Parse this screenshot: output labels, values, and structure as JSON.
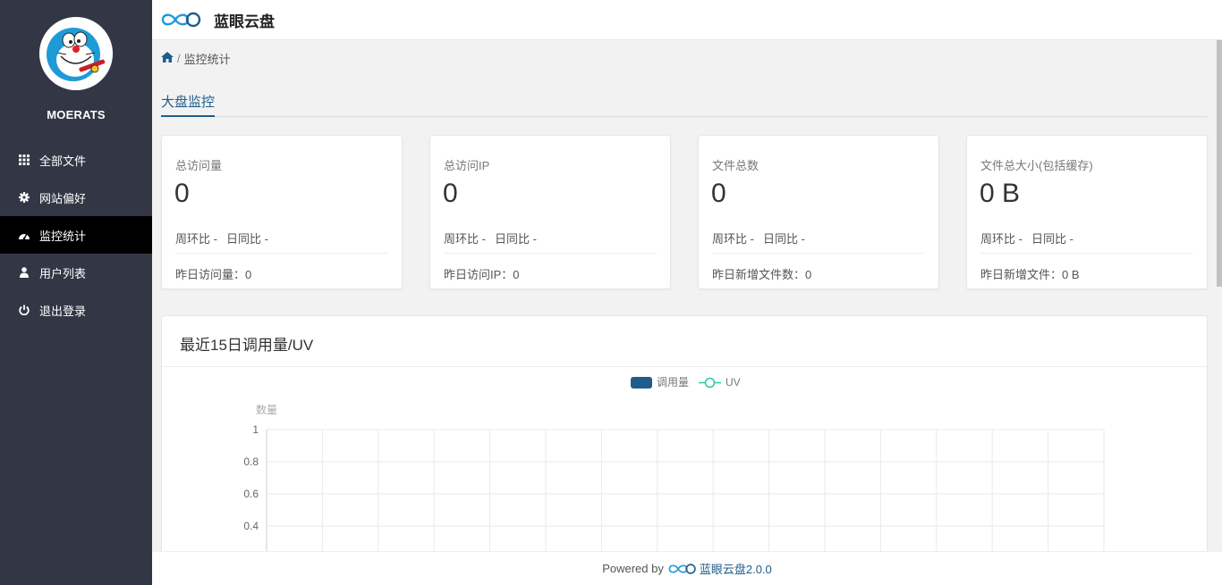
{
  "app": {
    "brand": "蓝眼云盘",
    "accent": "#1f5d8a",
    "legend_line_color": "#2ec7a4"
  },
  "sidebar": {
    "username": "MOERATS",
    "items": [
      {
        "label": "全部文件",
        "icon": "grid-icon"
      },
      {
        "label": "网站偏好",
        "icon": "gear-icon"
      },
      {
        "label": "监控统计",
        "icon": "dashboard-icon",
        "active": true
      },
      {
        "label": "用户列表",
        "icon": "user-icon"
      },
      {
        "label": "退出登录",
        "icon": "power-icon"
      }
    ]
  },
  "breadcrumb": {
    "sep": "/",
    "current": "监控统计"
  },
  "tab": {
    "label": "大盘监控"
  },
  "cards": [
    {
      "label": "总访问量",
      "value": "0",
      "wow": "周环比 -",
      "dod": "日同比 -",
      "footer": "昨日访问量：0"
    },
    {
      "label": "总访问IP",
      "value": "0",
      "wow": "周环比 -",
      "dod": "日同比 -",
      "footer": "昨日访问IP：0"
    },
    {
      "label": "文件总数",
      "value": "0",
      "wow": "周环比 -",
      "dod": "日同比 -",
      "footer": "昨日新增文件数：0"
    },
    {
      "label": "文件总大小(包括缓存)",
      "value": "0 B",
      "wow": "周环比 -",
      "dod": "日同比 -",
      "footer": "昨日新增文件：0 B"
    }
  ],
  "chart": {
    "title": "最近15日调用量/UV"
  },
  "chart_data": {
    "type": "bar",
    "title": "最近15日调用量/UV",
    "ylabel": "数量",
    "ylim": [
      0,
      1
    ],
    "yticks": [
      "1",
      "0.8",
      "0.6",
      "0.4"
    ],
    "num_categories": 15,
    "series": [
      {
        "name": "调用量",
        "type": "bar",
        "color": "#1f5d8a"
      },
      {
        "name": "UV",
        "type": "line",
        "color": "#2ec7a4"
      }
    ],
    "grid": true,
    "legend": "top-center"
  },
  "footer": {
    "prefix": "Powered by",
    "link": "蓝眼云盘2.0.0"
  }
}
